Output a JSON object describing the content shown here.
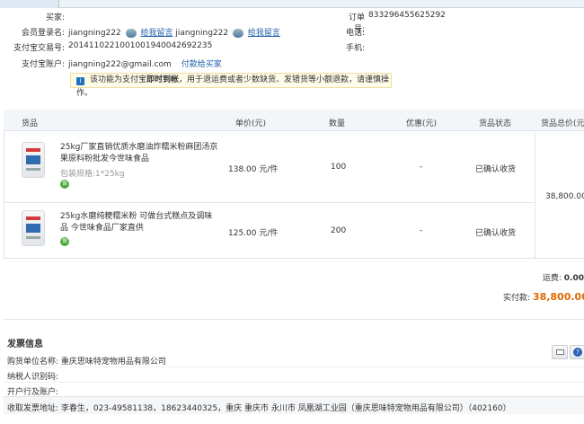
{
  "buyer": {
    "label": "买家:",
    "member_label": "会员登录名:",
    "member_name_1": "jiangning222",
    "leave_message_1": "给我留言",
    "member_name_2": "jiangning222",
    "leave_message_2": "给我留言",
    "alipay_txn_label": "支付宝交易号:",
    "alipay_txn": "2014110221001001940042692235",
    "alipay_account_label": "支付宝账户:",
    "alipay_account": "jiangning222@gmail.com",
    "pay_seller_link": "付款给买家"
  },
  "order": {
    "order_no_label": "订单号:",
    "order_no": "833296455625292",
    "phone_label": "电话:",
    "mobile_label": "手机:"
  },
  "tip": {
    "text_prefix": "该功能为支付宝",
    "text_highlight": "即时到帐",
    "text_suffix": "，用于退运费或者少数缺货、发错货等小额退款，请谨慎操作。"
  },
  "table": {
    "headers": {
      "goods": "货品",
      "unit_price": "单价(元)",
      "quantity": "数量",
      "discount": "优惠(元)",
      "status": "货品状态",
      "total": "货品总价(元)"
    },
    "rows": [
      {
        "title_line1": "25kg厂家直销优质水磨油炸糯米粉麻团汤京",
        "title_line2": "果原料粉批发今世味食品",
        "spec": "包装规格:1*25kg",
        "badge": "保",
        "price": "138.00 元/件",
        "qty": "100",
        "discount": "-",
        "status": "已确认收货"
      },
      {
        "title_line1": "25kg水磨纯粳糯米粉 可做台式糕点及调味",
        "title_line2": "品 今世味食品厂家直供",
        "badge": "保",
        "price": "125.00 元/件",
        "qty": "200",
        "discount": "-",
        "status": "已确认收货"
      }
    ],
    "goods_total": "38,800.00"
  },
  "summary": {
    "shipping_label": "运费:",
    "shipping_value": "0.00",
    "paid_label": "实付款:",
    "paid_value": "38,800.00"
  },
  "invoice": {
    "title": "发票信息",
    "unit_label": "购货单位名称:",
    "unit_value": "重庆思味特宠物用品有限公司",
    "taxpayer_label": "纳税人识别码:",
    "bank_label": "开户行及账户:",
    "address_label": "收取发票地址:",
    "address_value": "李春生，023-49581138，18623440325，重庆 重庆市 永川市 凤凰湖工业园（重庆思味特宠物用品有限公司）（402160）"
  },
  "colors": {
    "link": "#1f5fa8",
    "paid_amount": "#e06a00",
    "tip_bg": "#fefbe8",
    "badge": "#4caa3a"
  }
}
